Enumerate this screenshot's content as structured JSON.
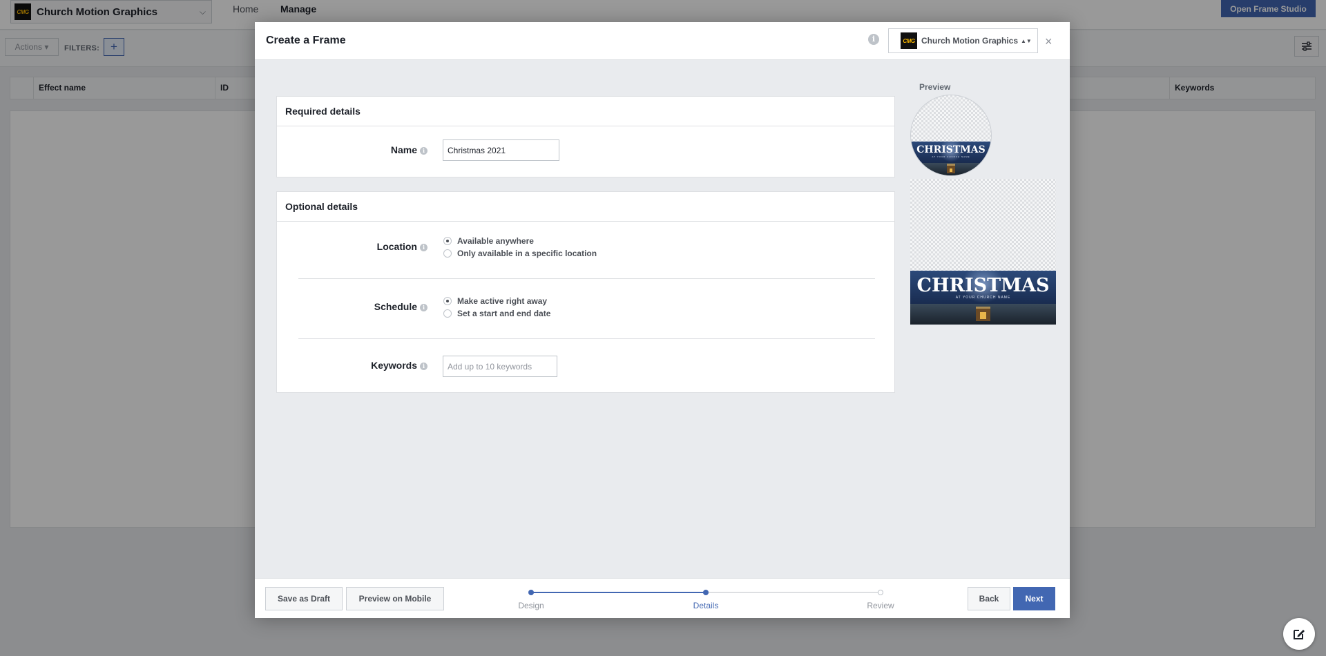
{
  "app": {
    "page_name": "Church Motion Graphics",
    "logo_text": "CMG",
    "nav_tabs": [
      {
        "label": "Home",
        "active": false
      },
      {
        "label": "Manage",
        "active": true
      }
    ],
    "open_studio_label": "Open Frame Studio"
  },
  "toolbar": {
    "actions_label": "Actions",
    "filters_label": "FILTERS:",
    "add_filter_label": "+"
  },
  "table": {
    "columns": [
      "Effect name",
      "ID",
      "Keywords"
    ]
  },
  "modal": {
    "title": "Create a Frame",
    "info_glyph": "i",
    "page_switch_name": "Church Motion Graphics",
    "page_switch_arrows": "▲▼",
    "close_glyph": "×",
    "required": {
      "heading": "Required details",
      "name_label": "Name",
      "name_value": "Christmas 2021"
    },
    "optional": {
      "heading": "Optional details",
      "location_label": "Location",
      "location_options": [
        {
          "label": "Available anywhere",
          "checked": true
        },
        {
          "label": "Only available in a specific location",
          "checked": false
        }
      ],
      "schedule_label": "Schedule",
      "schedule_options": [
        {
          "label": "Make active right away",
          "checked": true
        },
        {
          "label": "Set a start and end date",
          "checked": false
        }
      ],
      "keywords_label": "Keywords",
      "keywords_placeholder": "Add up to 10 keywords"
    },
    "preview": {
      "label": "Preview",
      "frame_title": "CHRISTMAS",
      "frame_subtitle": "AT YOUR CHURCH NAME"
    },
    "footer": {
      "save_draft_label": "Save as Draft",
      "preview_mobile_label": "Preview on Mobile",
      "steps": [
        {
          "label": "Design",
          "state": "done"
        },
        {
          "label": "Details",
          "state": "current"
        },
        {
          "label": "Review",
          "state": "upcoming"
        }
      ],
      "back_label": "Back",
      "next_label": "Next"
    }
  },
  "colors": {
    "accent": "#4267b2",
    "background": "#e9ebee"
  }
}
